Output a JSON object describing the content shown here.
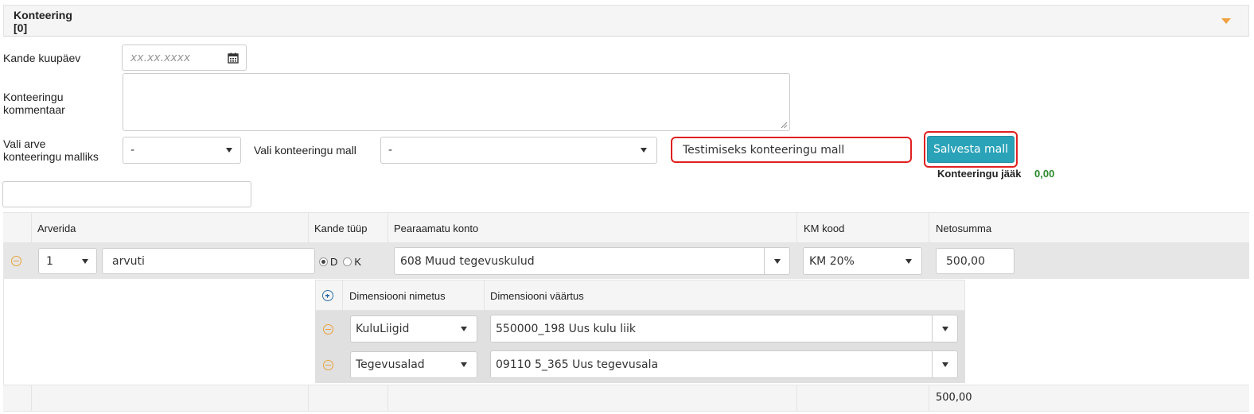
{
  "panel": {
    "title": "Konteering",
    "count": "[0]"
  },
  "form": {
    "date_label": "Kande kuupäev",
    "date_placeholder": "xx.xx.xxxx",
    "comment_label_1": "Konteeringu",
    "comment_label_2": "kommentaar",
    "invoice_tpl_label_1": "Vali arve",
    "invoice_tpl_label_2": "konteeringu malliks",
    "invoice_tpl_value": "-",
    "tpl_label": "Vali konteeringu mall",
    "tpl_value": "-",
    "tpl_name_value": "Testimiseks konteeringu mall",
    "save_button": "Salvesta mall",
    "balance_label": "Konteeringu jääk",
    "balance_value": "0,00"
  },
  "colors": {
    "accent": "#2aa3b9",
    "highlight": "#e02020",
    "balance": "#2b8a2b",
    "remove": "#e8a23a",
    "add": "#2f6fa5"
  },
  "icons": [
    "chevron-down-icon",
    "calendar-icon",
    "minus-circle-icon",
    "plus-circle-icon",
    "radio-icon"
  ],
  "table": {
    "headers": {
      "rows": "Arverida",
      "type": "Kande tüüp",
      "account": "Pearaamatu konto",
      "vat": "KM kood",
      "net": "Netosumma"
    },
    "row": {
      "line_no": "1",
      "description": "arvuti",
      "debit": "D",
      "credit": "K",
      "account": "608 Muud tegevuskulud",
      "vat": "KM 20%",
      "net": "500,00"
    },
    "dimensions": {
      "headers": {
        "name": "Dimensiooni nimetus",
        "value": "Dimensiooni väärtus"
      },
      "rows": [
        {
          "name": "KuluLiigid",
          "value": "550000_198 Uus kulu liik"
        },
        {
          "name": "Tegevusalad",
          "value": "09110 5_365 Uus tegevusala"
        }
      ]
    },
    "total": "500,00"
  }
}
